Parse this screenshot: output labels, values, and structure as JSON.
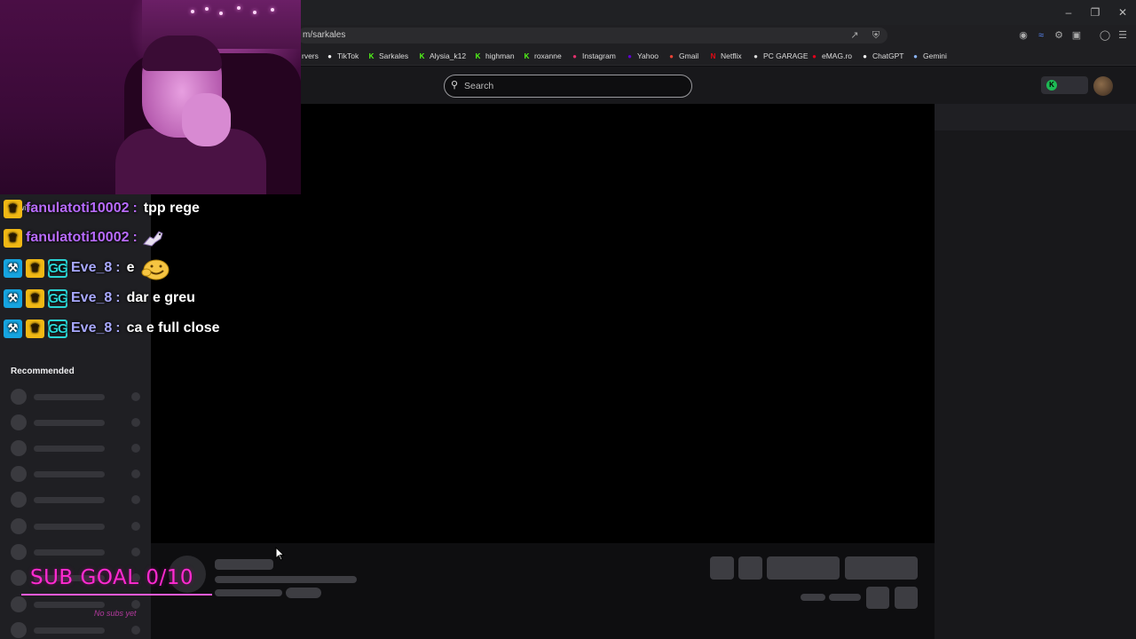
{
  "browser": {
    "address": "m/sarkales",
    "window_controls": [
      "minimize",
      "restore",
      "close"
    ],
    "bookmarks": [
      {
        "label": "rvers",
        "icon": "bookmark-icon",
        "color": "#888888"
      },
      {
        "label": "TikTok",
        "icon": "tiktok-icon",
        "color": "#ffffff"
      },
      {
        "label": "Sarkales",
        "icon": "kick-icon",
        "color": "#53fc18"
      },
      {
        "label": "Alysia_k12",
        "icon": "kick-icon",
        "color": "#53fc18"
      },
      {
        "label": "highman",
        "icon": "kick-icon",
        "color": "#53fc18"
      },
      {
        "label": "roxanne",
        "icon": "kick-icon",
        "color": "#53fc18"
      },
      {
        "label": "Instagram",
        "icon": "instagram-icon",
        "color": "#e1306c"
      },
      {
        "label": "Yahoo",
        "icon": "yahoo-icon",
        "color": "#6001d2"
      },
      {
        "label": "Gmail",
        "icon": "gmail-icon",
        "color": "#ea4335"
      },
      {
        "label": "Netflix",
        "icon": "netflix-icon",
        "color": "#e50914"
      },
      {
        "label": "PC GARAGE",
        "icon": "wrench-icon",
        "color": "#dddddd"
      },
      {
        "label": "eMAG.ro",
        "icon": "emag-icon",
        "color": "#e3001b"
      },
      {
        "label": "ChatGPT",
        "icon": "chatgpt-icon",
        "color": "#ffffff"
      },
      {
        "label": "Gemini",
        "icon": "gemini-icon",
        "color": "#8ab4f8"
      }
    ]
  },
  "topnav": {
    "search_placeholder": "Search"
  },
  "sidebar": {
    "recommended_label": "Recommended",
    "skeleton_rows": 10
  },
  "chat_overlay": {
    "messages": [
      {
        "badges": [
          "crown"
        ],
        "username": "fanulatoti10002",
        "text": "tpp rege",
        "emote": null
      },
      {
        "badges": [
          "crown"
        ],
        "username": "fanulatoti10002",
        "text": "",
        "emote": "pony-emote"
      },
      {
        "badges": [
          "mod",
          "crown",
          "gg"
        ],
        "username": "Eve_8",
        "text": "e",
        "emote": "smile-emote"
      },
      {
        "badges": [
          "mod",
          "crown",
          "gg"
        ],
        "username": "Eve_8",
        "text": "dar e greu",
        "emote": null
      },
      {
        "badges": [
          "mod",
          "crown",
          "gg"
        ],
        "username": "Eve_8",
        "text": "ca e full close",
        "emote": null
      }
    ],
    "ghost_label": "llowing"
  },
  "sub_goal": {
    "label": "SUB GOAL 0/10",
    "sub_text": "No subs yet",
    "current": 0,
    "target": 10
  },
  "colors": {
    "accent_pink": "#ff2bd0",
    "twitch_bg": "#0e0e10",
    "crown_badge": "#f1b814",
    "mod_badge": "#16a4e0"
  }
}
